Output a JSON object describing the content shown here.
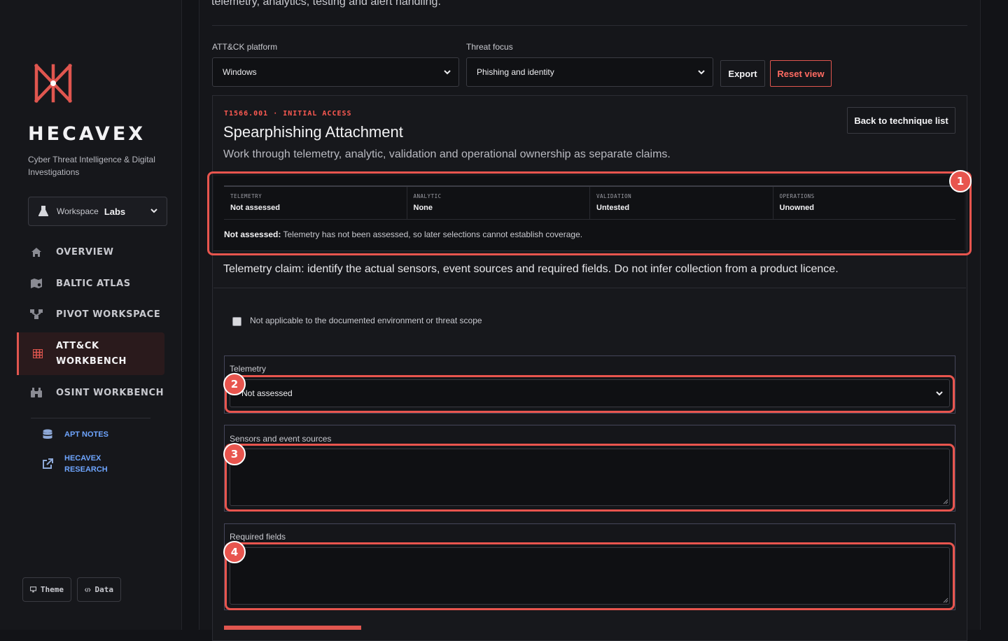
{
  "brand": {
    "name": "HECAVEX",
    "tagline": "Cyber Threat Intelligence & Digital Investigations"
  },
  "workspace": {
    "label": "Workspace",
    "name": "Labs"
  },
  "nav": [
    {
      "label": "OVERVIEW",
      "icon": "home-icon"
    },
    {
      "label": "BALTIC ATLAS",
      "icon": "map-icon"
    },
    {
      "label": "PIVOT WORKSPACE",
      "icon": "network-icon"
    },
    {
      "label": "ATT&CK WORKBENCH",
      "icon": "grid-icon",
      "active": true
    },
    {
      "label": "OSINT WORKBENCH",
      "icon": "binoculars-icon"
    }
  ],
  "sub_links": [
    {
      "label": "APT NOTES",
      "icon": "database-icon"
    },
    {
      "label": "HECAVEX RESEARCH",
      "icon": "external-link-icon"
    }
  ],
  "footer_buttons": {
    "theme": "Theme",
    "data": "Data"
  },
  "intro": "telemetry, analytics, testing and alert handling.",
  "filters": {
    "platform_label": "ATT&CK platform",
    "platform_value": "Windows",
    "focus_label": "Threat focus",
    "focus_value": "Phishing and identity"
  },
  "actions": {
    "export": "Export",
    "reset": "Reset view",
    "back": "Back to technique list"
  },
  "technique": {
    "id_line": "T1566.001 · INITIAL ACCESS",
    "title": "Spearphishing Attachment",
    "description": "Work through telemetry, analytic, validation and operational ownership as separate claims."
  },
  "status": [
    {
      "key": "TELEMETRY",
      "value": "Not assessed"
    },
    {
      "key": "ANALYTIC",
      "value": "None"
    },
    {
      "key": "VALIDATION",
      "value": "Untested"
    },
    {
      "key": "OPERATIONS",
      "value": "Unowned"
    }
  ],
  "status_note": {
    "lead": "Not assessed:",
    "text": "Telemetry has not been assessed, so later selections cannot establish coverage."
  },
  "claim": "Telemetry claim: identify the actual sensors, event sources and required fields. Do not infer collection from a product licence.",
  "not_applicable_label": "Not applicable to the documented environment or threat scope",
  "form": {
    "telemetry_label": "Telemetry",
    "telemetry_value": "Not assessed",
    "sensors_label": "Sensors and event sources",
    "sensors_value": "",
    "fields_label": "Required fields",
    "fields_value": ""
  },
  "annotations": [
    "1",
    "2",
    "3",
    "4"
  ],
  "colors": {
    "accent": "#e0564f",
    "link": "#6ea5ff",
    "background": "#121317"
  }
}
